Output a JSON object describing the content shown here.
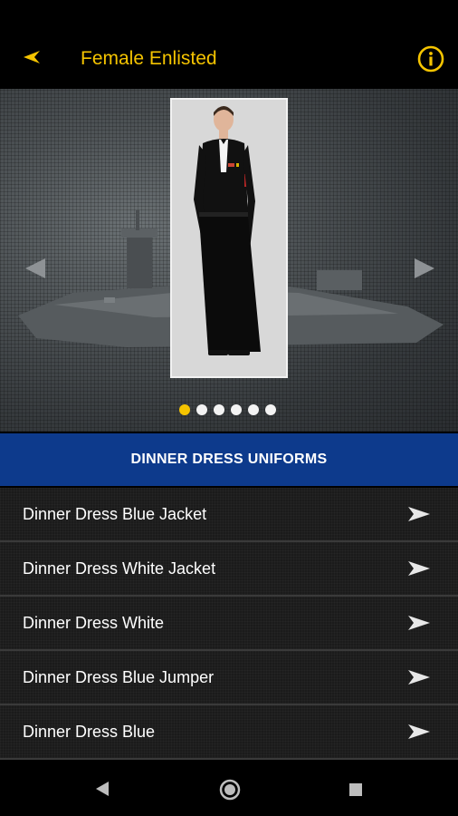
{
  "header": {
    "title": "Female Enlisted",
    "back_icon": "back-arrow-icon",
    "info_icon": "info-icon",
    "accent_color": "#f5c400"
  },
  "carousel": {
    "slide_count": 6,
    "active_index": 0,
    "prev_icon": "chevron-left-icon",
    "next_icon": "chevron-right-icon"
  },
  "section": {
    "title": "DINNER DRESS UNIFORMS",
    "color": "#0d3a8c"
  },
  "items": [
    {
      "label": "Dinner Dress Blue Jacket"
    },
    {
      "label": "Dinner Dress White Jacket"
    },
    {
      "label": "Dinner Dress White"
    },
    {
      "label": "Dinner Dress Blue Jumper"
    },
    {
      "label": "Dinner Dress Blue"
    }
  ],
  "navbar": {
    "back_icon": "nav-back-icon",
    "home_icon": "nav-home-icon",
    "recents_icon": "nav-recents-icon"
  }
}
